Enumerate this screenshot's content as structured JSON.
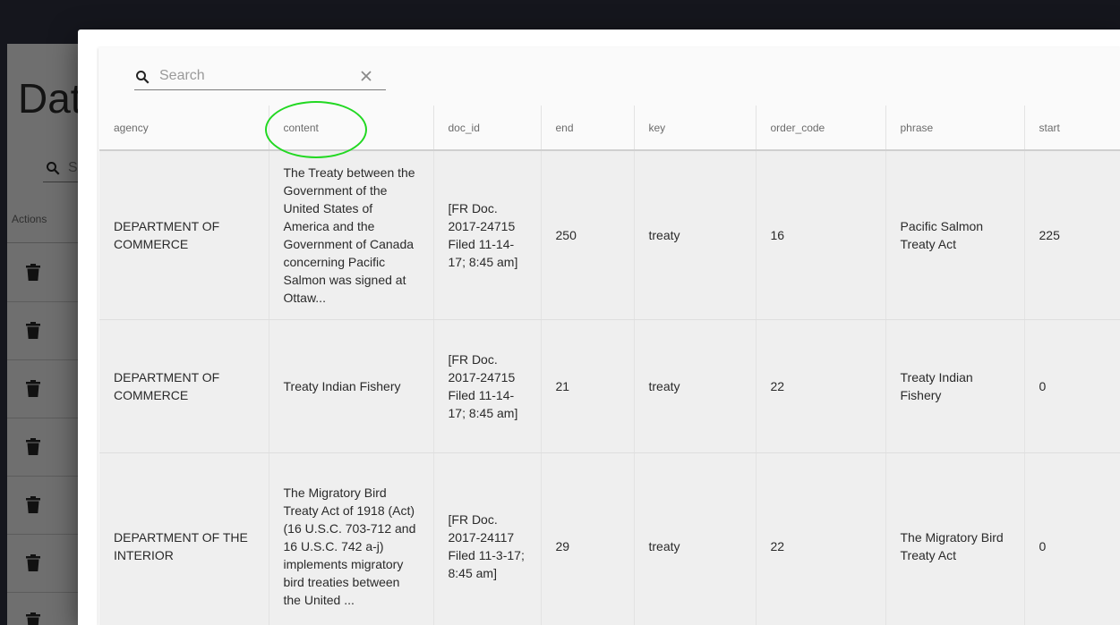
{
  "background": {
    "title": "Dat",
    "search_placeholder": "S",
    "actions_header": "Actions",
    "row_count": 7
  },
  "dialog": {
    "search": {
      "placeholder": "Search",
      "value": ""
    },
    "columns": [
      "agency",
      "content",
      "doc_id",
      "end",
      "key",
      "order_code",
      "phrase",
      "start"
    ],
    "rows": [
      {
        "agency": "DEPARTMENT OF COMMERCE",
        "content": "The Treaty between the Government of the United States of America and the Government of Canada concerning Pacific Salmon was signed at Ottaw...",
        "doc_id": "[FR Doc. 2017-24715 Filed 11-14-17; 8:45 am]",
        "end": "250",
        "key": "treaty",
        "order_code": "16",
        "phrase": "Pacific Salmon Treaty Act",
        "start": "225"
      },
      {
        "agency": "DEPARTMENT OF COMMERCE",
        "content": "Treaty Indian Fishery",
        "doc_id": "[FR Doc. 2017-24715 Filed 11-14-17; 8:45 am]",
        "end": "21",
        "key": "treaty",
        "order_code": "22",
        "phrase": "Treaty Indian Fishery",
        "start": "0"
      },
      {
        "agency": "DEPARTMENT OF THE INTERIOR",
        "content": "The Migratory Bird Treaty Act of 1918 (Act) (16 U.S.C. 703-712 and 16 U.S.C. 742 a-j) implements migratory bird treaties between the United ...",
        "doc_id": "[FR Doc. 2017-24117 Filed 11-3-17; 8:45 am]",
        "end": "29",
        "key": "treaty",
        "order_code": "22",
        "phrase": "The Migratory Bird Treaty Act",
        "start": "0"
      }
    ]
  },
  "colors": {
    "highlight_ring": "#22d822",
    "overlay": "#6f6f6f",
    "topbar": "#15161d"
  }
}
